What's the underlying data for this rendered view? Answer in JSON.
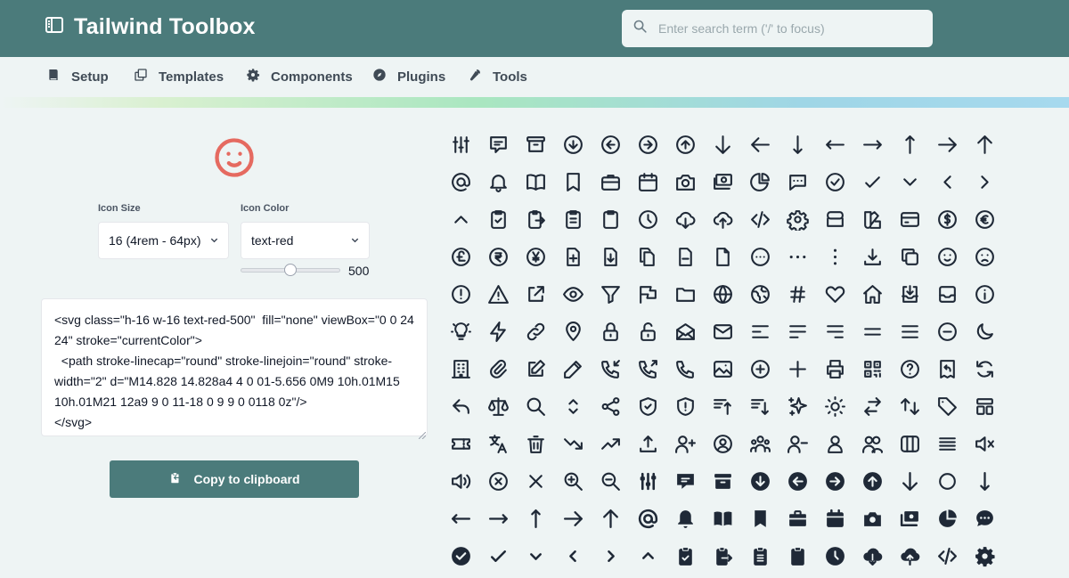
{
  "app": {
    "title": "Tailwind Toolbox"
  },
  "search": {
    "placeholder": "Enter search term ('/' to focus)"
  },
  "nav": [
    "Setup",
    "Templates",
    "Components",
    "Plugins",
    "Tools"
  ],
  "controls": {
    "icon_size_label": "Icon Size",
    "icon_size_value": "16 (4rem - 64px)",
    "icon_color_label": "Icon Color",
    "icon_color_value": "text-red",
    "shade_value": 500,
    "shade_display": "500"
  },
  "code": "<svg class=\"h-16 w-16 text-red-500\"  fill=\"none\" viewBox=\"0 0 24 24\" stroke=\"currentColor\">\n  <path stroke-linecap=\"round\" stroke-linejoin=\"round\" stroke-width=\"2\" d=\"M14.828 14.828a4 4 0 01-5.656 0M9 10h.01M15 10h.01M21 12a9 9 0 11-18 0 9 9 0 0118 0z\"/>\n</svg>",
  "copy_button": "Copy to clipboard",
  "colors": {
    "header": "#4b7b7b",
    "preview_icon": "#e56a60",
    "background": "#eef4f4"
  },
  "icons": [
    [
      "adjustments",
      "annotation",
      "archive",
      "arrow-circle-down",
      "arrow-circle-left",
      "arrow-circle-right",
      "arrow-circle-up",
      "arrow-down",
      "arrow-left",
      "arrow-narrow-down",
      "arrow-narrow-left",
      "arrow-narrow-right",
      "arrow-narrow-up",
      "arrow-right",
      "arrow-up"
    ],
    [
      "at-symbol",
      "bell",
      "book-open",
      "bookmark",
      "briefcase",
      "calendar",
      "camera",
      "cash",
      "chart-pie",
      "chat",
      "check-circle",
      "check",
      "chevron-down",
      "chevron-left",
      "chevron-right"
    ],
    [
      "chevron-up",
      "clipboard-check",
      "clipboard-copy",
      "clipboard-list",
      "clipboard",
      "clock",
      "cloud-download",
      "cloud-upload",
      "code",
      "cog",
      "database",
      "color-swatch",
      "credit-card",
      "currency-dollar",
      "currency-euro"
    ],
    [
      "currency-pound",
      "currency-rupee",
      "currency-yen",
      "document-add",
      "document-download",
      "document-duplicate",
      "document-remove",
      "document",
      "dots-circle-horizontal",
      "dots-horizontal",
      "dots-vertical",
      "download",
      "duplicate",
      "emoji-happy",
      "emoji-sad"
    ],
    [
      "exclamation-circle",
      "exclamation",
      "external-link",
      "eye",
      "filter",
      "flag",
      "folder",
      "globe",
      "globe-alt",
      "hashtag",
      "heart",
      "home",
      "inbox-in",
      "inbox",
      "information-circle"
    ],
    [
      "light-bulb",
      "lightning-bolt",
      "link",
      "location-marker",
      "lock-closed",
      "lock-open",
      "mail-open",
      "mail",
      "menu-alt-1",
      "menu-alt-2",
      "menu-alt-3",
      "menu-alt-4",
      "menu",
      "minus-circle",
      "moon"
    ],
    [
      "office-building",
      "paper-clip",
      "pencil-alt",
      "pencil",
      "phone-incoming",
      "phone-outgoing",
      "phone",
      "photograph",
      "plus-circle",
      "plus",
      "printer",
      "qrcode",
      "question-mark-circle",
      "receipt-refund",
      "refresh"
    ],
    [
      "reply",
      "scale",
      "search",
      "selector",
      "share",
      "shield-check",
      "shield-exclamation",
      "sort-ascending",
      "sort-descending",
      "sparkles",
      "sun",
      "switch-horizontal",
      "switch-vertical",
      "tag",
      "template"
    ],
    [
      "ticket",
      "translate",
      "trash",
      "trending-down",
      "trending-up",
      "upload",
      "user-add",
      "user-circle",
      "user-group",
      "user-remove",
      "user",
      "users",
      "view-boards",
      "view-list",
      "volume-off"
    ],
    [
      "volume-up",
      "x-circle",
      "x",
      "zoom-in",
      "zoom-out",
      "adjustments-solid",
      "annotation-solid",
      "archive-solid",
      "arrow-circle-down-solid",
      "arrow-circle-left-solid",
      "arrow-circle-right-solid",
      "arrow-circle-up-solid",
      "arrow-down-solid",
      "arrow-left-solid",
      "arrow-narrow-down-solid"
    ],
    [
      "arrow-narrow-left-solid",
      "arrow-narrow-right-solid",
      "arrow-narrow-up-solid",
      "arrow-right-solid",
      "arrow-up-solid",
      "at-symbol-solid",
      "bell-solid",
      "book-open-solid",
      "bookmark-solid",
      "briefcase-solid",
      "calendar-solid",
      "camera-solid",
      "cash-solid",
      "chart-pie-solid",
      "chat-solid"
    ],
    [
      "check-circle-solid",
      "check-solid",
      "chevron-down-solid",
      "chevron-left-solid",
      "chevron-right-solid",
      "chevron-up-solid",
      "clipboard-check-solid",
      "clipboard-copy-solid",
      "clipboard-list-solid",
      "clipboard-solid",
      "clock-solid",
      "cloud-download-solid",
      "cloud-upload-solid",
      "code-solid",
      "cog-solid"
    ]
  ]
}
